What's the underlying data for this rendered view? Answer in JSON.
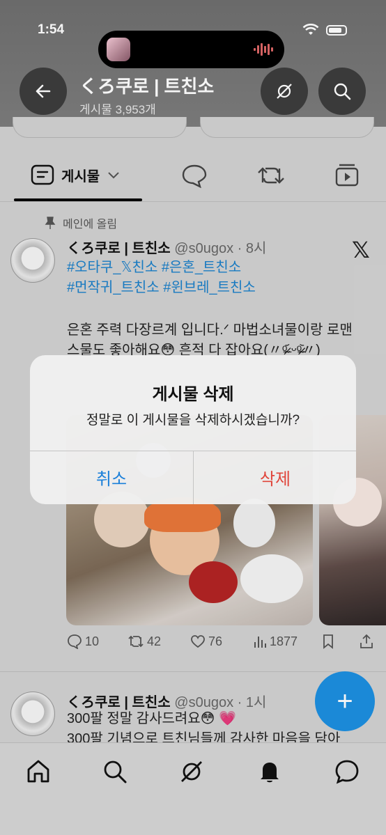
{
  "status_bar": {
    "time": "1:54"
  },
  "header": {
    "title": "くろ쿠로 | 트친소",
    "subtitle": "게시물 3,953개"
  },
  "tabs": {
    "posts_label": "게시물"
  },
  "tweet1": {
    "pinned_label": "메인에 올림",
    "name": "くろ쿠로 | 트친소",
    "handle": "@s0ugox · 8시",
    "hashtags_line1": "#오타쿠_𝕏친소 #은혼_트친소",
    "hashtags_line2": "#먼작귀_트친소 #윈브레_트친소",
    "body_line1": "은혼 주력 다장르계 입니다.ᐟ 마법소녀물이랑 로맨",
    "body_line2": "스물도 좋아해요😳 흔적 다 잡아요(〃ᵒ̴̶̷᷄ ᵕᵒ̴̶̷᷅〃)",
    "replies": "10",
    "retweets": "42",
    "likes": "76",
    "views": "1877"
  },
  "tweet2": {
    "name": "くろ쿠로 | 트친소",
    "handle": "@s0ugox · 1시",
    "body_line1": "300팔 정말 감사드려요😳 💗",
    "body_line2": "300팔 기념으로 트친님들께 감사한 마음을 담아"
  },
  "dialog": {
    "title": "게시물 삭제",
    "message": "정말로 이 게시물을 삭제하시겠습니까?",
    "cancel_label": "취소",
    "delete_label": "삭제"
  },
  "fab": {
    "label": "+"
  },
  "colors": {
    "accent": "#1d8fe0",
    "destructive": "#e0443a",
    "link": "#1a7fc9"
  }
}
